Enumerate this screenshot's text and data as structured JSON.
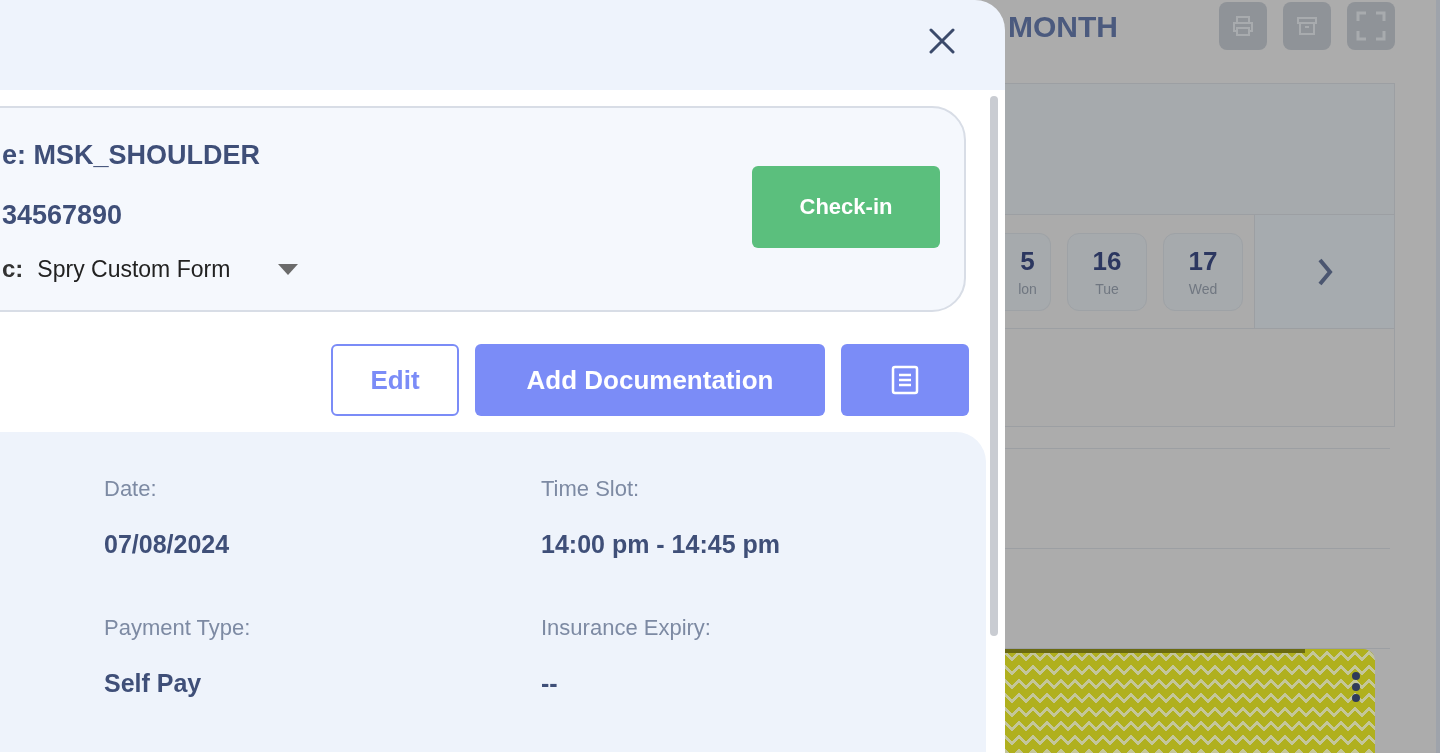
{
  "drawer": {
    "summary": {
      "lines": [
        "e: MSK_SHOULDER",
        "34567890"
      ],
      "template": {
        "label": "c:",
        "value": "Spry Custom Form"
      },
      "checkin": "Check-in"
    },
    "actions": {
      "edit": "Edit",
      "add": "Add Documentation"
    },
    "details": [
      {
        "label": "Date:",
        "value": "07/08/2024"
      },
      {
        "label": "Time Slot:",
        "value": "14:00 pm - 14:45 pm"
      },
      {
        "label": "Payment Type:",
        "value": "Self Pay"
      },
      {
        "label": "Insurance Expiry:",
        "value": "--"
      }
    ]
  },
  "background": {
    "heading": "MONTH",
    "days": [
      {
        "number": "5",
        "weekday": "lon"
      },
      {
        "number": "16",
        "weekday": "Tue"
      },
      {
        "number": "17",
        "weekday": "Wed"
      }
    ]
  }
}
